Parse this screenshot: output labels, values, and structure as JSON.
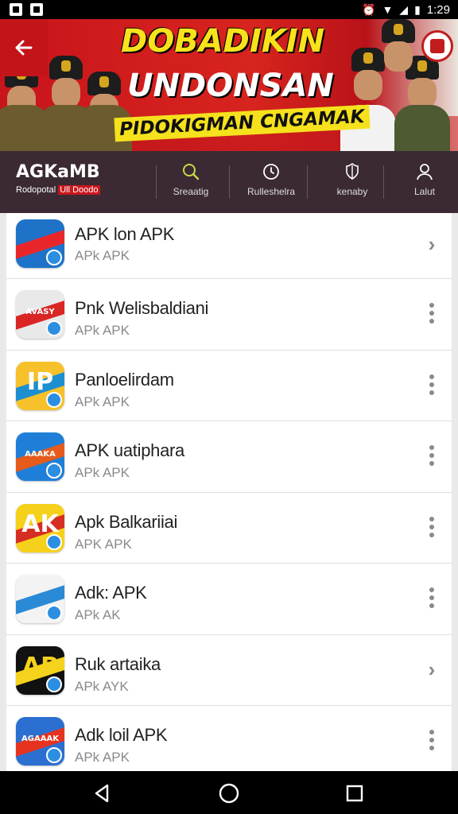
{
  "status_bar": {
    "time": "1:29",
    "icons": [
      "notification-icon",
      "photo-icon",
      "alarm-icon",
      "wifi-icon",
      "signal-icon",
      "battery-icon"
    ]
  },
  "banner": {
    "title_line1": "DOBADIKIN",
    "title_line2": "UNDONSAN",
    "subtitle": "PIDOKIGMAN CNGAMAK"
  },
  "brand": {
    "title": "AGKaMB",
    "subtitle_plain": "Rodopotal ",
    "subtitle_highlight": "Ull Doodo"
  },
  "nav": {
    "items": [
      {
        "label": "Sreaatig",
        "icon": "search-icon"
      },
      {
        "label": "Rulleshelra",
        "icon": "clock-icon"
      },
      {
        "label": "kenaby",
        "icon": "shield-icon"
      },
      {
        "label": "Lalut",
        "icon": "user-icon"
      }
    ]
  },
  "apps": [
    {
      "name": "APK lon APK",
      "subtitle": "APk APK",
      "action": "chevron",
      "icon_bg": "#1e73c9",
      "icon_accent": "#e8262a",
      "icon_text": ""
    },
    {
      "name": "Pnk Welisbaldiani",
      "subtitle": "APk APK",
      "action": "more",
      "icon_bg": "#e9e9e9",
      "icon_accent": "#d92625",
      "icon_text": "AVASY"
    },
    {
      "name": "Panloelirdam",
      "subtitle": "APk APK",
      "action": "more",
      "icon_bg": "#f6c12a",
      "icon_accent": "#1d8fd1",
      "icon_text": "IP"
    },
    {
      "name": "APK uatiphara",
      "subtitle": "APk APK",
      "action": "more",
      "icon_bg": "#1f7fd8",
      "icon_accent": "#e65a1c",
      "icon_text": "AAAKA"
    },
    {
      "name": "Apk Balkariiai",
      "subtitle": "APK APK",
      "action": "more",
      "icon_bg": "#f6d11c",
      "icon_accent": "#d62e22",
      "icon_text": "AK"
    },
    {
      "name": "Adk: APK",
      "subtitle": "APk AK",
      "action": "more",
      "icon_bg": "#f3f3f3",
      "icon_accent": "#2b8ad6",
      "icon_text": ""
    },
    {
      "name": "Ruk artaika",
      "subtitle": "APk AYK",
      "action": "chevron",
      "icon_bg": "#111111",
      "icon_accent": "#f5d21c",
      "icon_text": "AP"
    },
    {
      "name": "Adk loil APK",
      "subtitle": "APk APK",
      "action": "more",
      "icon_bg": "#2b6fd1",
      "icon_accent": "#e6331f",
      "icon_text": "AGAAAK"
    }
  ]
}
